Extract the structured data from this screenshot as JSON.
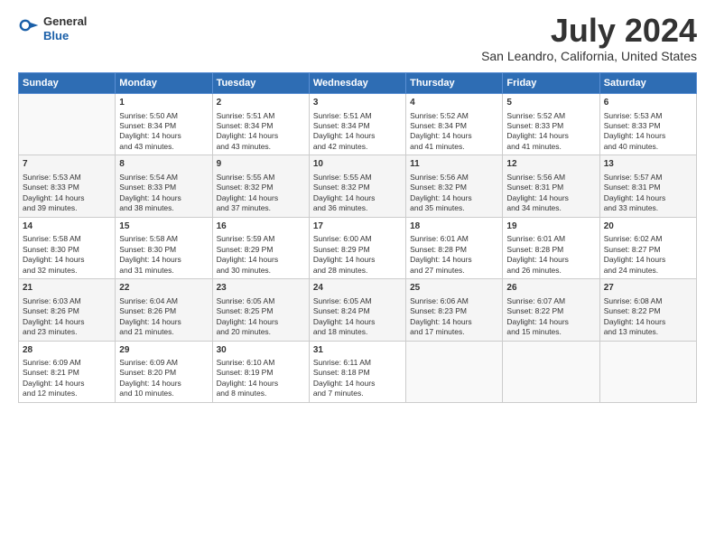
{
  "header": {
    "logo_general": "General",
    "logo_blue": "Blue",
    "title": "July 2024",
    "location": "San Leandro, California, United States"
  },
  "columns": [
    "Sunday",
    "Monday",
    "Tuesday",
    "Wednesday",
    "Thursday",
    "Friday",
    "Saturday"
  ],
  "weeks": [
    [
      {
        "day": "",
        "info": ""
      },
      {
        "day": "1",
        "info": "Sunrise: 5:50 AM\nSunset: 8:34 PM\nDaylight: 14 hours\nand 43 minutes."
      },
      {
        "day": "2",
        "info": "Sunrise: 5:51 AM\nSunset: 8:34 PM\nDaylight: 14 hours\nand 43 minutes."
      },
      {
        "day": "3",
        "info": "Sunrise: 5:51 AM\nSunset: 8:34 PM\nDaylight: 14 hours\nand 42 minutes."
      },
      {
        "day": "4",
        "info": "Sunrise: 5:52 AM\nSunset: 8:34 PM\nDaylight: 14 hours\nand 41 minutes."
      },
      {
        "day": "5",
        "info": "Sunrise: 5:52 AM\nSunset: 8:33 PM\nDaylight: 14 hours\nand 41 minutes."
      },
      {
        "day": "6",
        "info": "Sunrise: 5:53 AM\nSunset: 8:33 PM\nDaylight: 14 hours\nand 40 minutes."
      }
    ],
    [
      {
        "day": "7",
        "info": "Sunrise: 5:53 AM\nSunset: 8:33 PM\nDaylight: 14 hours\nand 39 minutes."
      },
      {
        "day": "8",
        "info": "Sunrise: 5:54 AM\nSunset: 8:33 PM\nDaylight: 14 hours\nand 38 minutes."
      },
      {
        "day": "9",
        "info": "Sunrise: 5:55 AM\nSunset: 8:32 PM\nDaylight: 14 hours\nand 37 minutes."
      },
      {
        "day": "10",
        "info": "Sunrise: 5:55 AM\nSunset: 8:32 PM\nDaylight: 14 hours\nand 36 minutes."
      },
      {
        "day": "11",
        "info": "Sunrise: 5:56 AM\nSunset: 8:32 PM\nDaylight: 14 hours\nand 35 minutes."
      },
      {
        "day": "12",
        "info": "Sunrise: 5:56 AM\nSunset: 8:31 PM\nDaylight: 14 hours\nand 34 minutes."
      },
      {
        "day": "13",
        "info": "Sunrise: 5:57 AM\nSunset: 8:31 PM\nDaylight: 14 hours\nand 33 minutes."
      }
    ],
    [
      {
        "day": "14",
        "info": "Sunrise: 5:58 AM\nSunset: 8:30 PM\nDaylight: 14 hours\nand 32 minutes."
      },
      {
        "day": "15",
        "info": "Sunrise: 5:58 AM\nSunset: 8:30 PM\nDaylight: 14 hours\nand 31 minutes."
      },
      {
        "day": "16",
        "info": "Sunrise: 5:59 AM\nSunset: 8:29 PM\nDaylight: 14 hours\nand 30 minutes."
      },
      {
        "day": "17",
        "info": "Sunrise: 6:00 AM\nSunset: 8:29 PM\nDaylight: 14 hours\nand 28 minutes."
      },
      {
        "day": "18",
        "info": "Sunrise: 6:01 AM\nSunset: 8:28 PM\nDaylight: 14 hours\nand 27 minutes."
      },
      {
        "day": "19",
        "info": "Sunrise: 6:01 AM\nSunset: 8:28 PM\nDaylight: 14 hours\nand 26 minutes."
      },
      {
        "day": "20",
        "info": "Sunrise: 6:02 AM\nSunset: 8:27 PM\nDaylight: 14 hours\nand 24 minutes."
      }
    ],
    [
      {
        "day": "21",
        "info": "Sunrise: 6:03 AM\nSunset: 8:26 PM\nDaylight: 14 hours\nand 23 minutes."
      },
      {
        "day": "22",
        "info": "Sunrise: 6:04 AM\nSunset: 8:26 PM\nDaylight: 14 hours\nand 21 minutes."
      },
      {
        "day": "23",
        "info": "Sunrise: 6:05 AM\nSunset: 8:25 PM\nDaylight: 14 hours\nand 20 minutes."
      },
      {
        "day": "24",
        "info": "Sunrise: 6:05 AM\nSunset: 8:24 PM\nDaylight: 14 hours\nand 18 minutes."
      },
      {
        "day": "25",
        "info": "Sunrise: 6:06 AM\nSunset: 8:23 PM\nDaylight: 14 hours\nand 17 minutes."
      },
      {
        "day": "26",
        "info": "Sunrise: 6:07 AM\nSunset: 8:22 PM\nDaylight: 14 hours\nand 15 minutes."
      },
      {
        "day": "27",
        "info": "Sunrise: 6:08 AM\nSunset: 8:22 PM\nDaylight: 14 hours\nand 13 minutes."
      }
    ],
    [
      {
        "day": "28",
        "info": "Sunrise: 6:09 AM\nSunset: 8:21 PM\nDaylight: 14 hours\nand 12 minutes."
      },
      {
        "day": "29",
        "info": "Sunrise: 6:09 AM\nSunset: 8:20 PM\nDaylight: 14 hours\nand 10 minutes."
      },
      {
        "day": "30",
        "info": "Sunrise: 6:10 AM\nSunset: 8:19 PM\nDaylight: 14 hours\nand 8 minutes."
      },
      {
        "day": "31",
        "info": "Sunrise: 6:11 AM\nSunset: 8:18 PM\nDaylight: 14 hours\nand 7 minutes."
      },
      {
        "day": "",
        "info": ""
      },
      {
        "day": "",
        "info": ""
      },
      {
        "day": "",
        "info": ""
      }
    ]
  ]
}
